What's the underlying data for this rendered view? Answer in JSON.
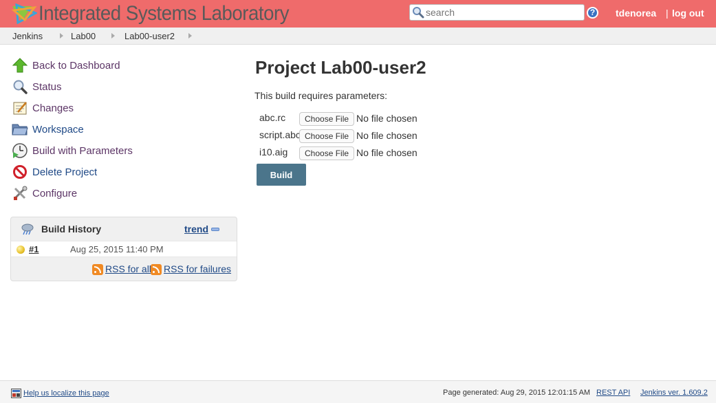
{
  "header": {
    "logo_text": "Integrated Systems Laboratory",
    "search_placeholder": "search",
    "help_label": "?",
    "user": "tdenorea",
    "separator": "|",
    "logout": "log out",
    "background_color": "#ef6b6b"
  },
  "breadcrumb": [
    "Jenkins",
    "Lab00",
    "Lab00-user2"
  ],
  "tasks": [
    {
      "label": "Back to Dashboard",
      "icon": "up-arrow-icon"
    },
    {
      "label": "Status",
      "icon": "magnifier-icon"
    },
    {
      "label": "Changes",
      "icon": "notepad-icon"
    },
    {
      "label": "Workspace",
      "icon": "folder-icon"
    },
    {
      "label": "Build with Parameters",
      "icon": "clock-icon"
    },
    {
      "label": "Delete Project",
      "icon": "no-entry-icon"
    },
    {
      "label": "Configure",
      "icon": "tools-icon"
    }
  ],
  "build_history": {
    "title": "Build History",
    "trend": "trend",
    "builds": [
      {
        "number": "#1",
        "date": "Aug 25, 2015 11:40 PM",
        "status": "yellow"
      }
    ],
    "rss_all": "RSS for all",
    "rss_failures": "RSS for failures"
  },
  "main": {
    "title": "Project Lab00-user2",
    "intro": "This build requires parameters:",
    "parameters": [
      {
        "name": "abc.rc",
        "button": "Choose File",
        "status": "No file chosen"
      },
      {
        "name": "script.abc",
        "button": "Choose File",
        "status": "No file chosen"
      },
      {
        "name": "i10.aig",
        "button": "Choose File",
        "status": "No file chosen"
      }
    ],
    "build_label": "Build"
  },
  "footer": {
    "localize": "Help us localize this page",
    "generated": "Page generated: Aug 29, 2015 12:01:15 AM",
    "rest_api": "REST API",
    "version": "Jenkins ver. 1.609.2"
  }
}
